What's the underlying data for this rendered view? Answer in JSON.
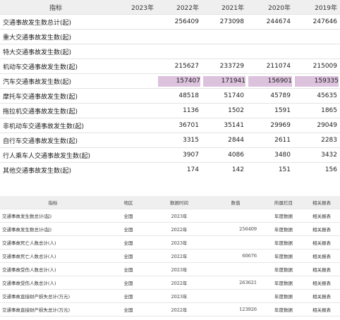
{
  "top_table": {
    "headers": [
      "指标",
      "2023年",
      "2022年",
      "2021年",
      "2020年",
      "2019年"
    ],
    "rows": [
      {
        "name": "交通事故发生数总计(起)",
        "values": [
          "",
          "256409",
          "273098",
          "244674",
          "247646"
        ],
        "highlight": false
      },
      {
        "name": "重大交通事故发生数(起)",
        "values": [
          "",
          "",
          "",
          "",
          ""
        ],
        "highlight": false
      },
      {
        "name": "特大交通事故发生数(起)",
        "values": [
          "",
          "",
          "",
          "",
          ""
        ],
        "highlight": false
      },
      {
        "name": "机动车交通事故发生数(起)",
        "values": [
          "",
          "215627",
          "233729",
          "211074",
          "215009"
        ],
        "highlight": false
      },
      {
        "name": "汽车交通事故发生数(起)",
        "values": [
          "",
          "157407",
          "171941",
          "156901",
          "159335"
        ],
        "highlight": true
      },
      {
        "name": "摩托车交通事故发生数(起)",
        "values": [
          "",
          "48518",
          "51740",
          "45789",
          "45635"
        ],
        "highlight": false
      },
      {
        "name": "拖拉机交通事故发生数(起)",
        "values": [
          "",
          "1136",
          "1502",
          "1591",
          "1865"
        ],
        "highlight": false
      },
      {
        "name": "非机动车交通事故发生数(起)",
        "values": [
          "",
          "36701",
          "35141",
          "29969",
          "29049"
        ],
        "highlight": false
      },
      {
        "name": "自行车交通事故发生数(起)",
        "values": [
          "",
          "3315",
          "2844",
          "2611",
          "2283"
        ],
        "highlight": false
      },
      {
        "name": "行人乘车人交通事故发生数(起)",
        "values": [
          "",
          "3907",
          "4086",
          "3480",
          "3432"
        ],
        "highlight": false
      },
      {
        "name": "其他交通事故发生数(起)",
        "values": [
          "",
          "174",
          "142",
          "151",
          "156"
        ],
        "highlight": false
      }
    ]
  },
  "bottom_table": {
    "headers": [
      "指标",
      "地区",
      "数据时间",
      "数值",
      "所属栏目",
      "相关报表"
    ],
    "rows": [
      {
        "name": "交通事故发生数总计(起)",
        "region": "全国",
        "time": "2023年",
        "value": "",
        "column": "年度数据",
        "report": "相关报表"
      },
      {
        "name": "交通事故发生数总计(起)",
        "region": "全国",
        "time": "2022年",
        "value": "256409",
        "column": "年度数据",
        "report": "相关报表"
      },
      {
        "name": "交通事故死亡人数总计(人)",
        "region": "全国",
        "time": "2023年",
        "value": "",
        "column": "年度数据",
        "report": "相关报表"
      },
      {
        "name": "交通事故死亡人数总计(人)",
        "region": "全国",
        "time": "2022年",
        "value": "60676",
        "column": "年度数据",
        "report": "相关报表"
      },
      {
        "name": "交通事故受伤人数总计(人)",
        "region": "全国",
        "time": "2023年",
        "value": "",
        "column": "年度数据",
        "report": "相关报表"
      },
      {
        "name": "交通事故受伤人数总计(人)",
        "region": "全国",
        "time": "2022年",
        "value": "263621",
        "column": "年度数据",
        "report": "相关报表"
      },
      {
        "name": "交通事故直接财产损失总计(万元)",
        "region": "全国",
        "time": "2023年",
        "value": "",
        "column": "年度数据",
        "report": "相关报表"
      },
      {
        "name": "交通事故直接财产损失总计(万元)",
        "region": "全国",
        "time": "2022年",
        "value": "123926",
        "column": "年度数据",
        "report": "相关报表"
      }
    ]
  },
  "colors": {
    "highlight": "#dcc2dd",
    "header_bg": "#efefef"
  }
}
